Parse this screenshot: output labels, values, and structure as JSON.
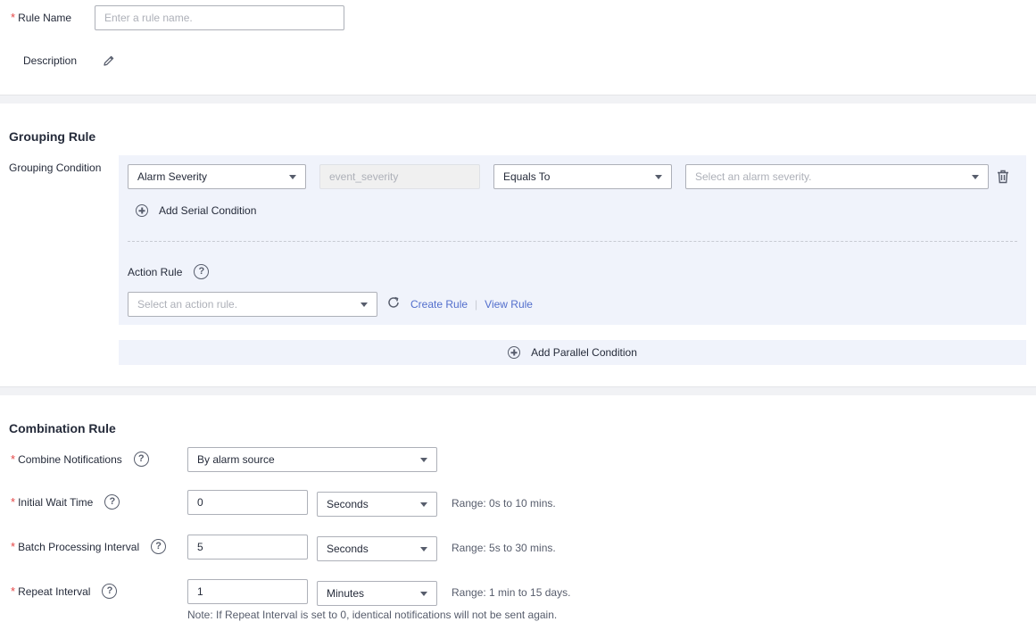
{
  "basic": {
    "rule_name_label": "Rule Name",
    "rule_name_placeholder": "Enter a rule name.",
    "description_label": "Description"
  },
  "grouping": {
    "title": "Grouping Rule",
    "condition_label": "Grouping Condition",
    "field_select": "Alarm Severity",
    "field_key": "event_severity",
    "operator_select": "Equals To",
    "value_placeholder": "Select an alarm severity.",
    "add_serial": "Add Serial Condition",
    "action_rule_label": "Action Rule",
    "action_rule_placeholder": "Select an action rule.",
    "create_rule": "Create Rule",
    "view_rule": "View Rule",
    "add_parallel": "Add Parallel Condition"
  },
  "combination": {
    "title": "Combination Rule",
    "combine_label": "Combine Notifications",
    "combine_value": "By alarm source",
    "initial_wait_label": "Initial Wait Time",
    "initial_wait_value": "0",
    "initial_wait_unit": "Seconds",
    "initial_wait_range": "Range: 0s to 10 mins.",
    "batch_label": "Batch Processing Interval",
    "batch_value": "5",
    "batch_unit": "Seconds",
    "batch_range": "Range: 5s to 30 mins.",
    "repeat_label": "Repeat Interval",
    "repeat_value": "1",
    "repeat_unit": "Minutes",
    "repeat_range": "Range: 1 min to 15 days.",
    "repeat_note": "Note: If Repeat Interval is set to 0, identical notifications will not be sent again."
  },
  "colors": {
    "link": "#526ecc",
    "required": "#e54545",
    "panel": "#f0f3fb"
  }
}
